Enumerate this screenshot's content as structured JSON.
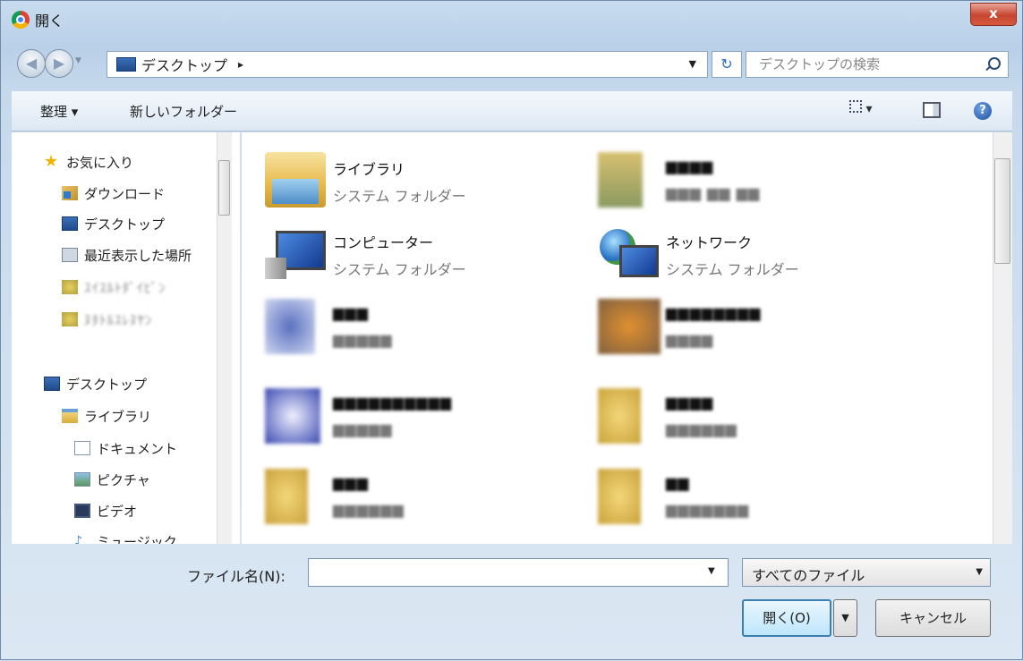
{
  "window": {
    "title": "開く",
    "close_label": "x"
  },
  "nav": {
    "address": "デスクトップ",
    "address_sep": "▸",
    "search_placeholder": "デスクトップの検索"
  },
  "toolbar": {
    "organize_label": "整理 ▾",
    "new_folder_label": "新しいフォルダー",
    "view_label": "▾",
    "help_label": "?"
  },
  "sidebar": {
    "items": [
      {
        "label": "お気に入り",
        "icon": "star-icon"
      },
      {
        "label": "ダウンロード",
        "icon": "downloads-folder-icon"
      },
      {
        "label": "デスクトップ",
        "icon": "desktop-icon"
      },
      {
        "label": "最近表示した場所",
        "icon": "recent-places-icon"
      },
      {
        "label": "ｽｲｽﾙﾄﾀﾞｲﾋﾞﾝ",
        "icon": "blurred-folder-icon"
      },
      {
        "label": "ﾇﾀﾄﾙｽﾚﾇﾔﾝ",
        "icon": "blurred-folder-icon"
      },
      {
        "label": "デスクトップ",
        "icon": "desktop-icon"
      },
      {
        "label": "ライブラリ",
        "icon": "library-icon"
      },
      {
        "label": "ドキュメント",
        "icon": "documents-icon"
      },
      {
        "label": "ピクチャ",
        "icon": "pictures-icon"
      },
      {
        "label": "ビデオ",
        "icon": "videos-icon"
      },
      {
        "label": "ミュージック",
        "icon": "music-icon"
      }
    ]
  },
  "content": {
    "tiles": [
      {
        "name": "ライブラリ",
        "type": "システム フォルダー",
        "icon": "library-folder-icon"
      },
      {
        "name": "▆▆▆▆",
        "type": "▆▆▆ ▆▆ ▆▆",
        "icon": "blurred-user-icon"
      },
      {
        "name": "コンピューター",
        "type": "システム フォルダー",
        "icon": "computer-icon"
      },
      {
        "name": "ネットワーク",
        "type": "システム フォルダー",
        "icon": "network-icon"
      },
      {
        "name": "▆▆▆",
        "type": "▆▆▆▆▆",
        "icon": "blurred-shortcut-icon"
      },
      {
        "name": "▆▆▆▆▆▆▆▆",
        "type": "▆▆▆▆",
        "icon": "blurred-image-icon"
      },
      {
        "name": "▆▆▆▆▆▆▆▆▆▆",
        "type": "▆▆▆▆▆",
        "icon": "blurred-shortcut-icon"
      },
      {
        "name": "▆▆▆▆",
        "type": "▆▆▆▆▆▆",
        "icon": "blurred-folder-icon"
      },
      {
        "name": "▆▆▆",
        "type": "▆▆▆▆▆▆",
        "icon": "blurred-folder-icon"
      },
      {
        "name": "▆▆",
        "type": "▆▆▆▆▆▆▆",
        "icon": "blurred-folder-icon"
      }
    ]
  },
  "footer": {
    "filename_label": "ファイル名(N):",
    "filename_value": "",
    "filetype_value": "すべてのファイル",
    "open_label": "開く(O)",
    "cancel_label": "キャンセル"
  }
}
